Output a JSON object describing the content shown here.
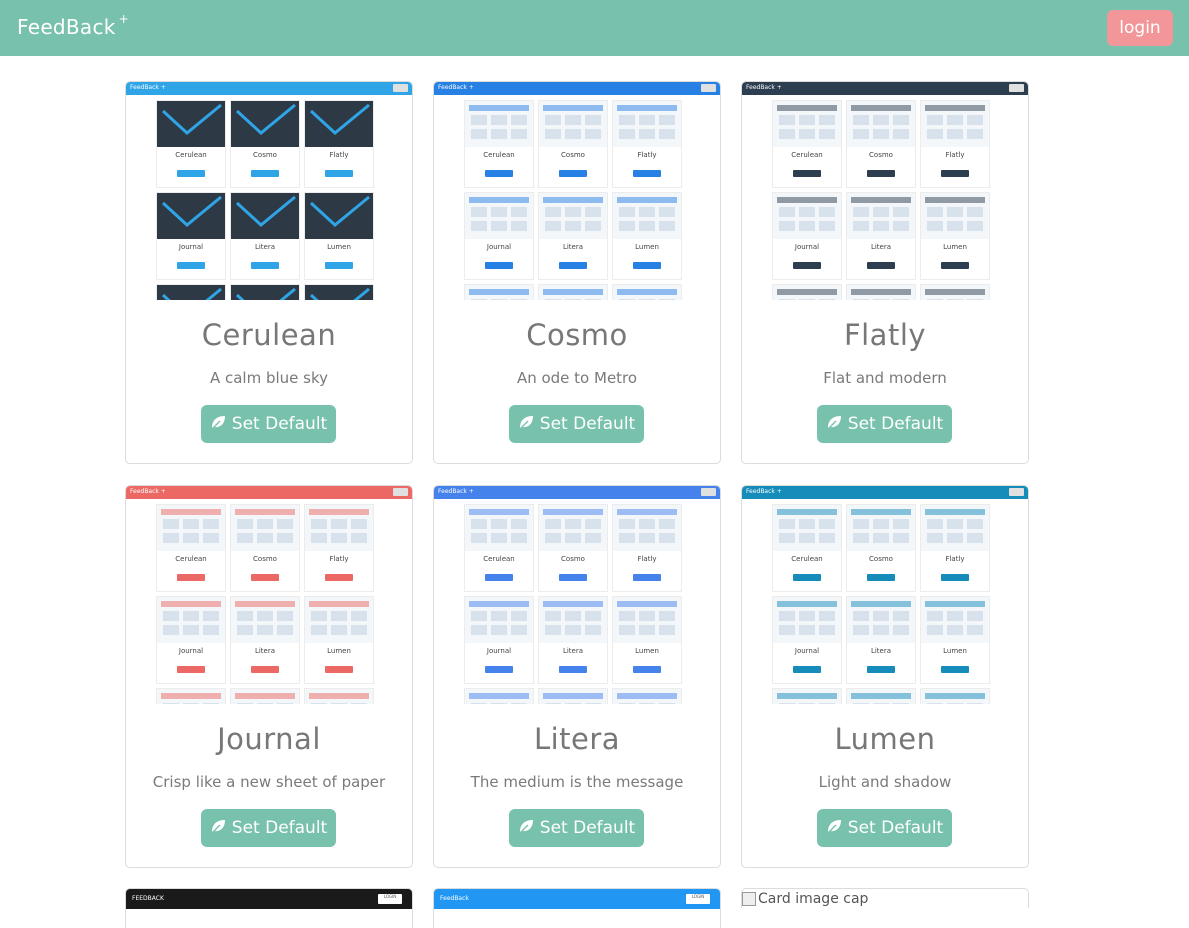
{
  "navbar": {
    "brand": "FeedBack",
    "brand_sup": "+",
    "login_label": "login"
  },
  "theme_cards": [
    {
      "title": "Cerulean",
      "subtitle": "A calm blue sky",
      "button": "Set Default",
      "bar_color": "#2fa4e7",
      "accent": "#2fa4e7"
    },
    {
      "title": "Cosmo",
      "subtitle": "An ode to Metro",
      "button": "Set Default",
      "bar_color": "#2780e3",
      "accent": "#2780e3"
    },
    {
      "title": "Flatly",
      "subtitle": "Flat and modern",
      "button": "Set Default",
      "bar_color": "#2c3e50",
      "accent": "#2c3e50"
    },
    {
      "title": "Journal",
      "subtitle": "Crisp like a new sheet of paper",
      "button": "Set Default",
      "bar_color": "#eb6864",
      "accent": "#eb6864"
    },
    {
      "title": "Litera",
      "subtitle": "The medium is the message",
      "button": "Set Default",
      "bar_color": "#4582ec",
      "accent": "#4582ec"
    },
    {
      "title": "Lumen",
      "subtitle": "Light and shadow",
      "button": "Set Default",
      "bar_color": "#158cba",
      "accent": "#158cba"
    }
  ],
  "partial_cards": [
    {
      "bar_color": "#1a1a1a",
      "brand": "FEEDBACK",
      "login": "LOGIN"
    },
    {
      "bar_color": "#2196f3",
      "brand": "FeedBack",
      "login": "LOGIN"
    }
  ],
  "broken_image_alt": "Card image cap",
  "colors": {
    "primary": "#78c2ad",
    "secondary": "#f3969a"
  }
}
